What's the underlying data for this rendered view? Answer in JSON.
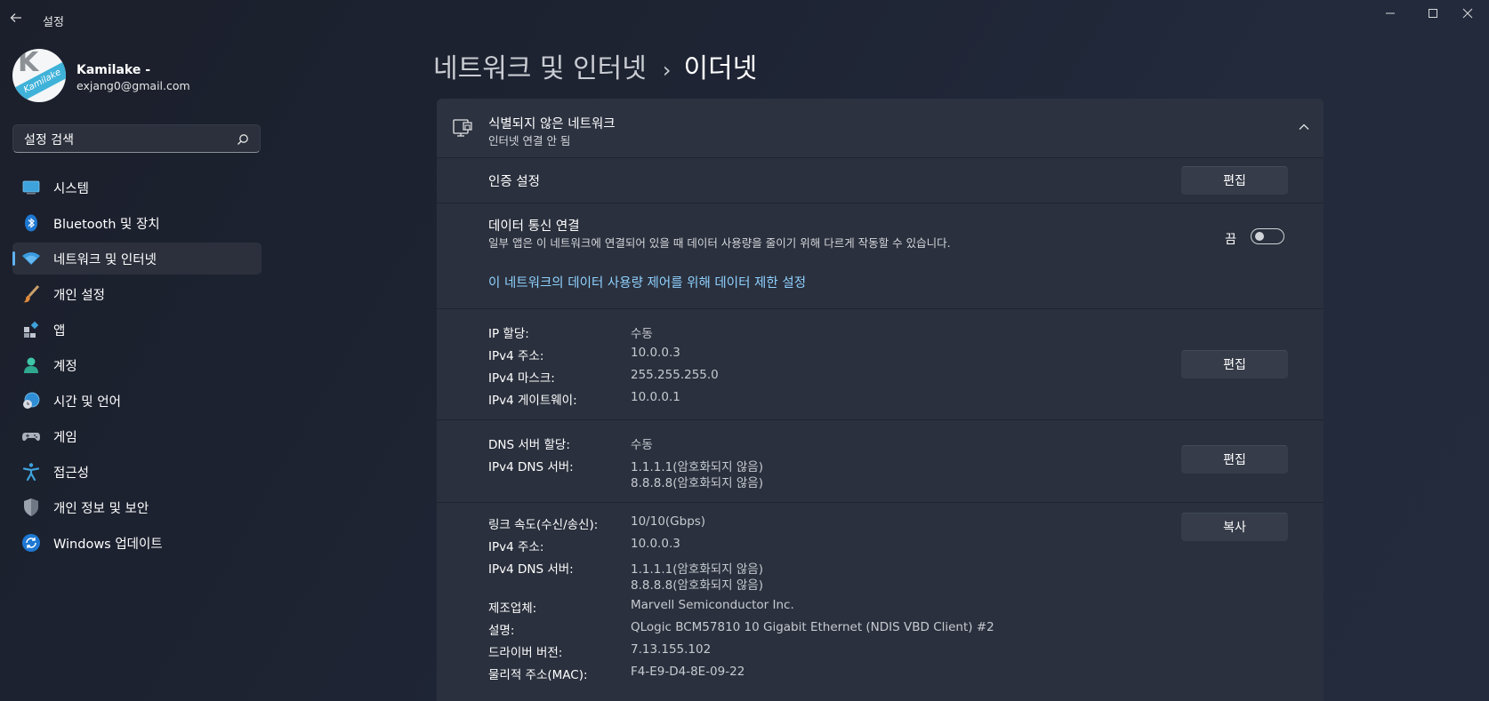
{
  "window": {
    "title": "설정"
  },
  "profile": {
    "name": "Kamilake -",
    "email": "exjang0@gmail.com",
    "avatar_letter": "K",
    "avatar_band": "Kamilake"
  },
  "search": {
    "placeholder": "설정 검색"
  },
  "nav": {
    "items": [
      {
        "label": "시스템",
        "icon": "system-icon"
      },
      {
        "label": "Bluetooth 및 장치",
        "icon": "bluetooth-icon"
      },
      {
        "label": "네트워크 및 인터넷",
        "icon": "wifi-icon",
        "active": true
      },
      {
        "label": "개인 설정",
        "icon": "brush-icon"
      },
      {
        "label": "앱",
        "icon": "apps-icon"
      },
      {
        "label": "계정",
        "icon": "account-icon"
      },
      {
        "label": "시간 및 언어",
        "icon": "globe-clock-icon"
      },
      {
        "label": "게임",
        "icon": "gamepad-icon"
      },
      {
        "label": "접근성",
        "icon": "accessibility-icon"
      },
      {
        "label": "개인 정보 및 보안",
        "icon": "shield-icon"
      },
      {
        "label": "Windows 업데이트",
        "icon": "update-icon"
      }
    ]
  },
  "breadcrumb": {
    "parent": "네트워크 및 인터넷",
    "separator": "›",
    "current": "이더넷"
  },
  "network": {
    "name": "식별되지 않은 네트워크",
    "status": "인터넷 연결 안 됨"
  },
  "auth": {
    "title": "인증 설정",
    "button": "편집"
  },
  "metered": {
    "title": "데이터 통신 연결",
    "description": "일부 앱은 이 네트워크에 연결되어 있을 때 데이터 사용량을 줄이기 위해 다르게 작동할 수 있습니다.",
    "toggle_label": "끔",
    "toggle_on": false,
    "link": "이 네트워크의 데이터 사용량 제어를 위해 데이터 제한 설정"
  },
  "ip": {
    "button": "편집",
    "rows": [
      {
        "key": "IP 할당:",
        "value": "수동"
      },
      {
        "key": "IPv4 주소:",
        "value": "10.0.0.3"
      },
      {
        "key": "IPv4 마스크:",
        "value": "255.255.255.0"
      },
      {
        "key": "IPv4 게이트웨이:",
        "value": "10.0.0.1"
      }
    ]
  },
  "dns": {
    "button": "편집",
    "assignment_key": "DNS 서버 할당:",
    "assignment_value": "수동",
    "server_key": "IPv4 DNS 서버:",
    "server_value_1": "1.1.1.1(암호화되지 않음)",
    "server_value_2": "8.8.8.8(암호화되지 않음)"
  },
  "props": {
    "button": "복사",
    "link_speed_key": "링크 속도(수신/송신):",
    "link_speed_value": "10/10(Gbps)",
    "ipv4_key": "IPv4 주소:",
    "ipv4_value": "10.0.0.3",
    "dns_key": "IPv4 DNS 서버:",
    "dns_value_1": "1.1.1.1(암호화되지 않음)",
    "dns_value_2": "8.8.8.8(암호화되지 않음)",
    "manufacturer_key": "제조업체:",
    "manufacturer_value": "Marvell Semiconductor Inc.",
    "description_key": "설명:",
    "description_value": "QLogic BCM57810 10 Gigabit Ethernet (NDIS VBD Client) #2",
    "driver_key": "드라이버 버전:",
    "driver_value": "7.13.155.102",
    "mac_key": "물리적 주소(MAC):",
    "mac_value": "F4-E9-D4-8E-09-22"
  }
}
